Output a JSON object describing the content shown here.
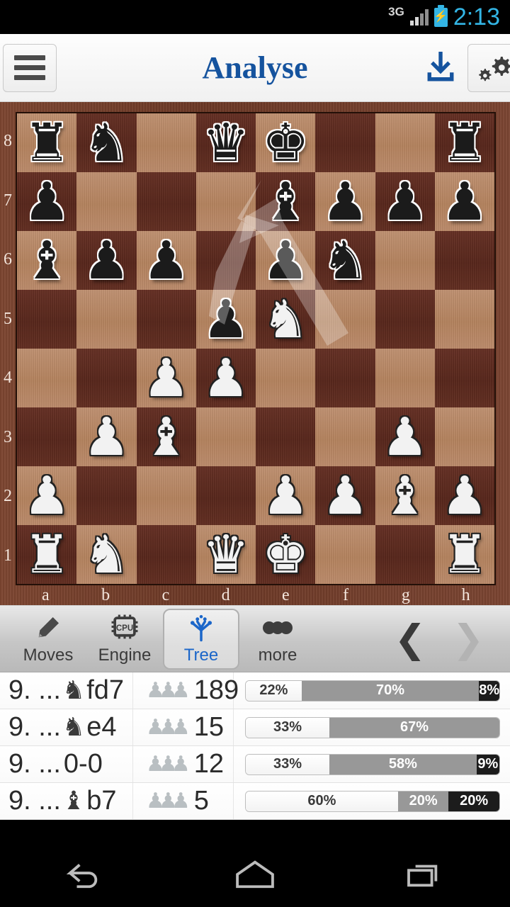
{
  "status_bar": {
    "network": "3G",
    "time": "2:13",
    "battery_icon": "battery-charging-icon",
    "signal_icon": "signal-bars-icon"
  },
  "header": {
    "title": "Analyse",
    "menu_icon": "hamburger-menu-icon",
    "download_icon": "download-icon",
    "settings_icon": "settings-gears-icon",
    "title_color": "#15539e"
  },
  "board": {
    "files": [
      "a",
      "b",
      "c",
      "d",
      "e",
      "f",
      "g",
      "h"
    ],
    "ranks": [
      "8",
      "7",
      "6",
      "5",
      "4",
      "3",
      "2",
      "1"
    ],
    "light_square_color": "#b5845f",
    "dark_square_color": "#5a281d",
    "border_color": "#6b3826",
    "position": [
      [
        "r",
        "n",
        "",
        "q",
        "k",
        "",
        "",
        "r"
      ],
      [
        "p",
        "",
        "",
        "",
        "b",
        "p",
        "p",
        "p"
      ],
      [
        "b",
        "p",
        "p",
        "",
        "p",
        "n",
        "",
        ""
      ],
      [
        "",
        "",
        "",
        "p",
        "N",
        "",
        "",
        ""
      ],
      [
        "",
        "",
        "P",
        "P",
        "",
        "",
        "",
        ""
      ],
      [
        "",
        "P",
        "B",
        "",
        "",
        "",
        "P",
        ""
      ],
      [
        "P",
        "",
        "",
        "",
        "P",
        "P",
        "B",
        "P"
      ],
      [
        "R",
        "N",
        "",
        "Q",
        "K",
        "",
        "",
        "R"
      ]
    ],
    "last_move_arrow": {
      "from": "f3",
      "to": "e5"
    }
  },
  "toolbar": {
    "items": [
      {
        "label": "Moves",
        "icon": "pencil-icon",
        "active": false
      },
      {
        "label": "Engine",
        "icon": "cpu-chip-icon",
        "active": false
      },
      {
        "label": "Tree",
        "icon": "tree-icon",
        "active": true
      },
      {
        "label": "more",
        "icon": "three-dots-icon",
        "active": false
      }
    ],
    "prev_icon": "chevron-left-icon",
    "next_icon": "chevron-right-icon",
    "prev_enabled": true,
    "next_enabled": false,
    "active_color": "#1b66c9"
  },
  "move_list": {
    "games_icon": "pawn-count-icon",
    "rows": [
      {
        "move_number": "9. ...",
        "piece_glyph": "♞",
        "move": "fd7",
        "games": "189",
        "white_pct": "22%",
        "draw_pct": "70%",
        "black_pct": "8%",
        "white": 22,
        "draw": 70,
        "black": 8
      },
      {
        "move_number": "9. ...",
        "piece_glyph": "♞",
        "move": "e4",
        "games": "15",
        "white_pct": "33%",
        "draw_pct": "67%",
        "black_pct": "",
        "white": 33,
        "draw": 67,
        "black": 0
      },
      {
        "move_number": "9. ...",
        "piece_glyph": "",
        "move": "0-0",
        "games": "12",
        "white_pct": "33%",
        "draw_pct": "58%",
        "black_pct": "9%",
        "white": 33,
        "draw": 58,
        "black": 9
      },
      {
        "move_number": "9. ...",
        "piece_glyph": "♝",
        "move": "b7",
        "games": "5",
        "white_pct": "60%",
        "draw_pct": "20%",
        "black_pct": "20%",
        "white": 60,
        "draw": 20,
        "black": 20
      }
    ]
  },
  "system_nav": {
    "back_icon": "back-arrow-icon",
    "home_icon": "home-icon",
    "recents_icon": "recent-apps-icon"
  }
}
